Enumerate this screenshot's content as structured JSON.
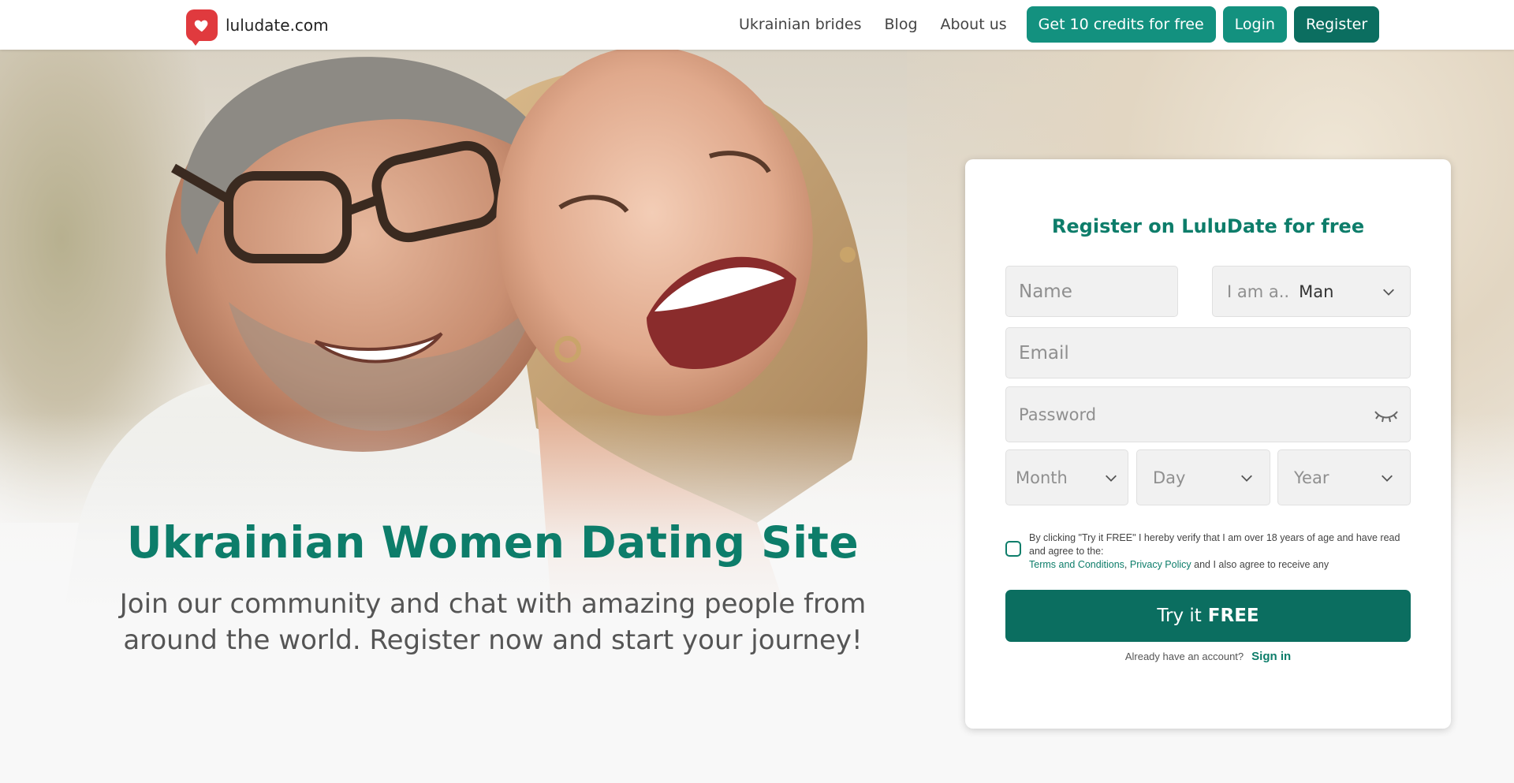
{
  "header": {
    "logo_text": "luludate.com",
    "nav": {
      "brides": "Ukrainian brides",
      "blog": "Blog",
      "about": "About us"
    },
    "buttons": {
      "credits": "Get 10 credits for free",
      "login": "Login",
      "register": "Register"
    }
  },
  "hero": {
    "title": "Ukrainian Women Dating Site",
    "subtitle": "Join our community and chat with amazing people from around the world. Register now and start your journey!"
  },
  "form": {
    "title": "Register on LuluDate for free",
    "name_placeholder": "Name",
    "gender_prefix": "I am a..",
    "gender_value": "Man",
    "email_placeholder": "Email",
    "password_placeholder": "Password",
    "month": "Month",
    "day": "Day",
    "year": "Year",
    "consent_text": "By clicking \"Try it FREE\" I hereby verify that I am over 18 years of age and have read and agree to the:",
    "terms": "Terms and Conditions",
    "privacy": "Privacy Policy",
    "consent_tail": "and I also agree to receive any",
    "submit_prefix": "Try it",
    "submit_bold": "FREE",
    "have_account": "Already have an account?",
    "sign_in": "Sign in"
  },
  "colors": {
    "brand_green": "#0d7d6a",
    "button_green": "#13917f",
    "dark_green": "#0b6e60",
    "logo_red": "#e03a3e"
  },
  "icons": [
    "heart-icon",
    "chevron-down-icon",
    "eye-closed-icon"
  ]
}
